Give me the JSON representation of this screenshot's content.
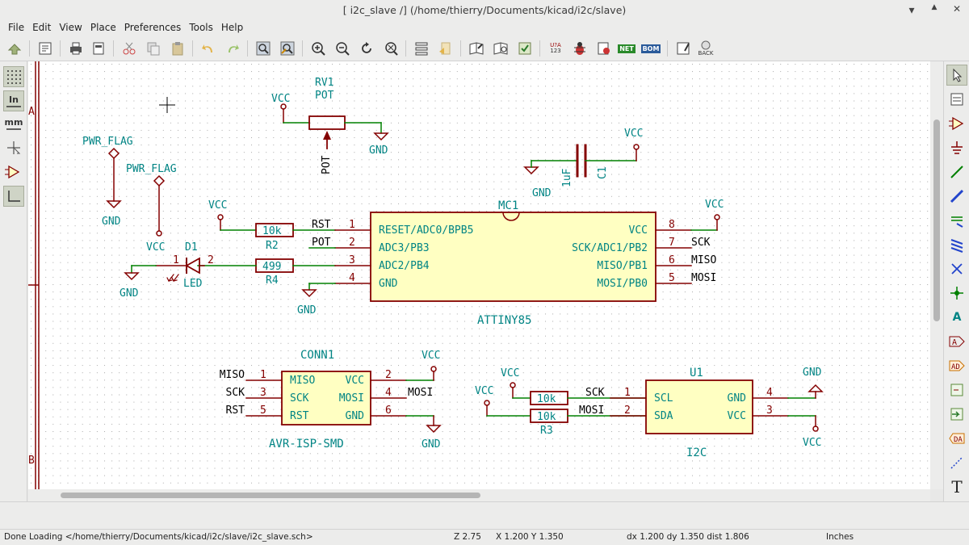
{
  "window": {
    "title": "[ i2c_slave /] (/home/thierry/Documents/kicad/i2c/slave)",
    "controls": {
      "minimize": "▲",
      "maximize": "▲",
      "close": "✕"
    }
  },
  "menu": [
    "File",
    "Edit",
    "View",
    "Place",
    "Preferences",
    "Tools",
    "Help"
  ],
  "toolbar": {
    "icons": [
      "save-icon",
      "page-settings-icon",
      "print-icon",
      "plot-icon",
      "cut-icon",
      "copy-icon",
      "paste-icon",
      "undo-icon",
      "redo-icon",
      "find-icon",
      "find-replace-icon",
      "zoom-in-icon",
      "zoom-out-icon",
      "zoom-redraw-icon",
      "zoom-fit-icon",
      "hierarchy-navigator-icon",
      "leave-sheet-icon",
      "library-editor-icon",
      "library-browser-icon",
      "annotate-icon",
      "erc-icon",
      "netlist-icon",
      "bom-icon",
      "cvpcb-icon",
      "pcbnew-icon",
      "import-footprint-icon",
      "back-annotate-icon"
    ],
    "annotate_label": "U?A",
    "annotate_sub": "123",
    "netlist_label": "NET",
    "bom_label": "BOM",
    "back_label": "BACK"
  },
  "left_toolbar": {
    "inch_label": "In",
    "mm_label": "mm"
  },
  "right_toolbar": {
    "text_label": "T",
    "label_label": "A"
  },
  "schematic": {
    "border": {
      "row_a": "A",
      "row_b": "B"
    },
    "power": {
      "vcc": "VCC",
      "gnd": "GND",
      "pwr_flag": "PWR_FLAG"
    },
    "rv1": {
      "ref": "RV1",
      "value": "POT",
      "wiper": "POT"
    },
    "c1": {
      "ref": "C1",
      "value": "1uF"
    },
    "mc1": {
      "ref": "MC1",
      "value": "ATTINY85",
      "left_pins": [
        {
          "num": "1",
          "name": "RESET/ADC0/BPB5",
          "net": "RST"
        },
        {
          "num": "2",
          "name": "ADC3/PB3",
          "net": "POT"
        },
        {
          "num": "3",
          "name": "ADC2/PB4",
          "net": ""
        },
        {
          "num": "4",
          "name": "GND",
          "net": ""
        }
      ],
      "right_pins": [
        {
          "num": "8",
          "name": "VCC",
          "net": ""
        },
        {
          "num": "7",
          "name": "SCK/ADC1/PB2",
          "net": "SCK"
        },
        {
          "num": "6",
          "name": "MISO/PB1",
          "net": "MISO"
        },
        {
          "num": "5",
          "name": "MOSI/PB0",
          "net": "MOSI"
        }
      ]
    },
    "r2": {
      "ref": "R2",
      "value": "10k"
    },
    "r4": {
      "ref": "R4",
      "value": "499"
    },
    "r3": {
      "ref": "R3",
      "value": "10k"
    },
    "r_hidden_value": "10k",
    "d1": {
      "ref": "D1",
      "value": "LED",
      "pin1": "1",
      "pin2": "2"
    },
    "conn1": {
      "ref": "CONN1",
      "value": "AVR-ISP-SMD",
      "left_pins": [
        {
          "num": "1",
          "name": "MISO",
          "net": "MISO"
        },
        {
          "num": "3",
          "name": "SCK",
          "net": "SCK"
        },
        {
          "num": "5",
          "name": "RST",
          "net": "RST"
        }
      ],
      "right_pins": [
        {
          "num": "2",
          "name": "VCC",
          "net": ""
        },
        {
          "num": "4",
          "name": "MOSI",
          "net": "MOSI"
        },
        {
          "num": "6",
          "name": "GND",
          "net": ""
        }
      ]
    },
    "u1": {
      "ref": "U1",
      "value": "I2C",
      "left_pins": [
        {
          "num": "1",
          "name": "SCL",
          "net": "SCK"
        },
        {
          "num": "2",
          "name": "SDA",
          "net": "MOSI"
        }
      ],
      "right_pins": [
        {
          "num": "4",
          "name": "GND"
        },
        {
          "num": "3",
          "name": "VCC"
        }
      ]
    }
  },
  "status": {
    "message": "Done Loading </home/thierry/Documents/kicad/i2c/slave/i2c_slave.sch>",
    "zoom": "Z 2.75",
    "xy": "X 1.200  Y 1.350",
    "delta": "dx 1.200  dy 1.350  dist 1.806",
    "units": "Inches"
  },
  "colors": {
    "wire": "#008000",
    "part": "#840000",
    "part_fill": "#ffffc2",
    "text": "#008484",
    "label": "#000000"
  }
}
